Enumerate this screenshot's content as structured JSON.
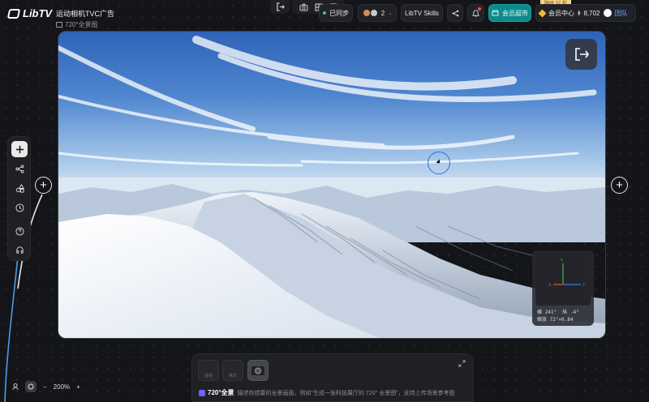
{
  "app": {
    "name": "LibTV"
  },
  "project": {
    "title": "运动相机TVC广告",
    "subtitle": "720°全景图"
  },
  "topbar": {
    "sync_label": "已同步",
    "collaborators_count": "2",
    "skills_label": "LibTV Skills",
    "market_label": "会员超市",
    "member_label": "会员中心",
    "points": "8,702",
    "team_label": "团队",
    "promo_label": "限时 37 折"
  },
  "viewer": {
    "gizmo_line1": "横 241°  纵 -4°",
    "gizmo_line2": "缩放 72°×0.84",
    "axis_labels": {
      "y": "Y",
      "z": "Z",
      "x": "X"
    }
  },
  "bottom_panel": {
    "slot1_label": "首帧",
    "slot2_label": "格式",
    "mode_label": "720°全景",
    "prompt_placeholder": "描述你想要的全景画面，例如“生成一张科技展厅的 720° 全景图”，支持上传场景参考图"
  },
  "zoom": {
    "level": "200%",
    "minus": "−",
    "plus": "+"
  },
  "colors": {
    "accent_teal": "#0f8a8a",
    "accent_blue": "#2f6fd6",
    "sync_green": "#3ecf6b",
    "team_blue": "#5ab0ff"
  },
  "icons": [
    "logout-icon",
    "camera-icon",
    "grid-icon",
    "share-icon",
    "bell-icon",
    "plus-icon",
    "nodes-icon",
    "shapes-icon",
    "clock-icon",
    "help-icon",
    "headset-icon",
    "expand-icon",
    "user-icon",
    "zoom-fit-icon"
  ]
}
